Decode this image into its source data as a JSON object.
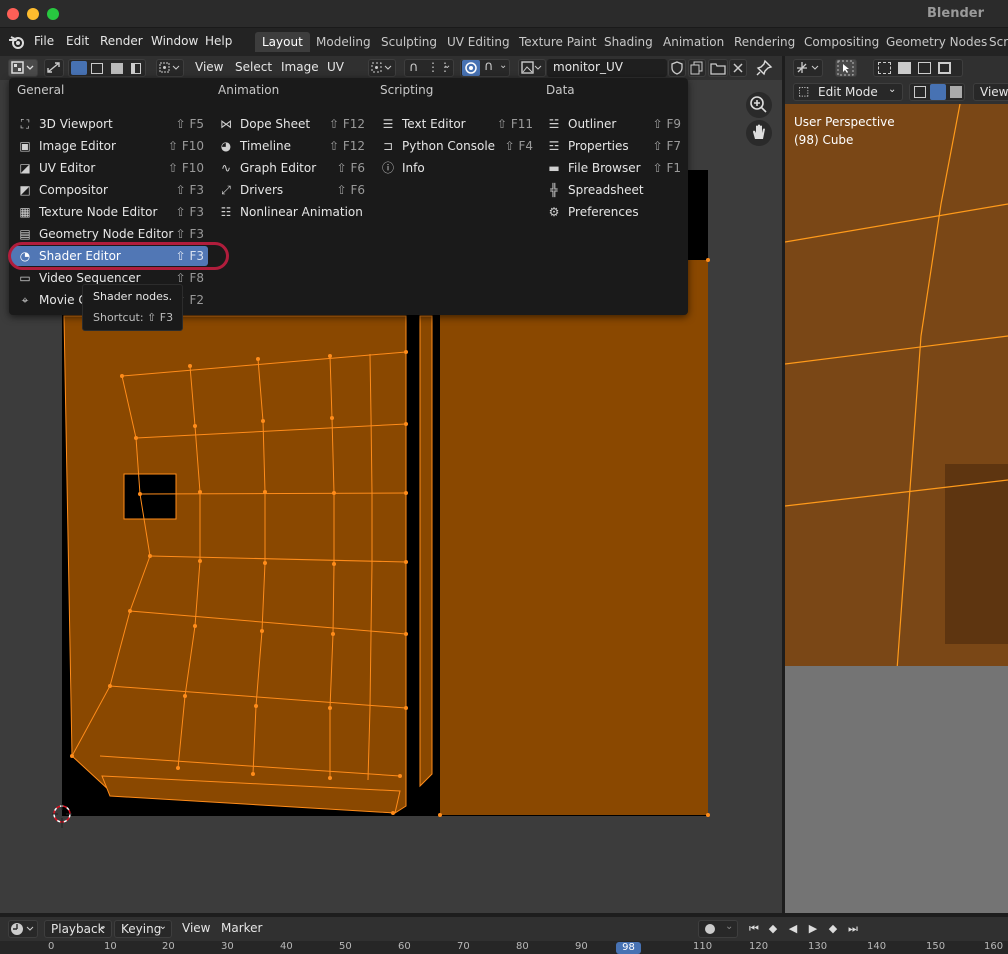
{
  "window": {
    "title": "Blender"
  },
  "menubar": {
    "items": [
      "File",
      "Edit",
      "Render",
      "Window",
      "Help"
    ]
  },
  "workspaces": [
    "Layout",
    "Modeling",
    "Sculpting",
    "UV Editing",
    "Texture Paint",
    "Shading",
    "Animation",
    "Rendering",
    "Compositing",
    "Geometry Nodes",
    "Scri"
  ],
  "uv_header": {
    "menus": [
      "View",
      "Select",
      "Image",
      "UV"
    ],
    "image_name": "monitor_UV"
  },
  "popup": {
    "columns": [
      {
        "title": "General",
        "items": [
          {
            "label": "3D Viewport",
            "shortcut": "⇧ F5",
            "icon": "cube-icon"
          },
          {
            "label": "Image Editor",
            "shortcut": "⇧ F10",
            "icon": "image-icon"
          },
          {
            "label": "UV Editor",
            "shortcut": "⇧ F10",
            "icon": "uv-icon"
          },
          {
            "label": "Compositor",
            "shortcut": "⇧ F3",
            "icon": "node-icon"
          },
          {
            "label": "Texture Node Editor",
            "shortcut": "⇧ F3",
            "icon": "checker-icon"
          },
          {
            "label": "Geometry Node Editor",
            "shortcut": "⇧ F3",
            "icon": "geometry-icon"
          },
          {
            "label": "Shader Editor",
            "shortcut": "⇧ F3",
            "icon": "shader-icon"
          },
          {
            "label": "Video Sequencer",
            "shortcut": "⇧ F8",
            "icon": "film-icon"
          },
          {
            "label": "Movie Clip Editor",
            "shortcut": "⇧ F2",
            "icon": "tracker-icon"
          }
        ]
      },
      {
        "title": "Animation",
        "items": [
          {
            "label": "Dope Sheet",
            "shortcut": "⇧ F12",
            "icon": "dopesheet-icon"
          },
          {
            "label": "Timeline",
            "shortcut": "⇧ F12",
            "icon": "clock-icon"
          },
          {
            "label": "Graph Editor",
            "shortcut": "⇧ F6",
            "icon": "graph-icon"
          },
          {
            "label": "Drivers",
            "shortcut": "⇧ F6",
            "icon": "drivers-icon"
          },
          {
            "label": "Nonlinear Animation",
            "shortcut": "",
            "icon": "nla-icon"
          }
        ]
      },
      {
        "title": "Scripting",
        "items": [
          {
            "label": "Text Editor",
            "shortcut": "⇧ F11",
            "icon": "text-icon"
          },
          {
            "label": "Python Console",
            "shortcut": "⇧ F4",
            "icon": "console-icon"
          },
          {
            "label": "Info",
            "shortcut": "",
            "icon": "info-icon"
          }
        ]
      },
      {
        "title": "Data",
        "items": [
          {
            "label": "Outliner",
            "shortcut": "⇧ F9",
            "icon": "outliner-icon"
          },
          {
            "label": "Properties",
            "shortcut": "⇧ F7",
            "icon": "properties-icon"
          },
          {
            "label": "File Browser",
            "shortcut": "⇧ F1",
            "icon": "folder-icon"
          },
          {
            "label": "Spreadsheet",
            "shortcut": "",
            "icon": "spreadsheet-icon"
          },
          {
            "label": "Preferences",
            "shortcut": "",
            "icon": "gear-icon"
          }
        ]
      }
    ],
    "tooltip": {
      "description": "Shader nodes.",
      "shortcut": "Shortcut: ⇧ F3"
    }
  },
  "viewport": {
    "mode": "Edit Mode",
    "view_menu": "View",
    "perspective": "User Perspective",
    "object": "(98) Cube"
  },
  "timeline": {
    "menus": [
      "Playback",
      "Keying",
      "View",
      "Marker"
    ],
    "ticks": [
      "0",
      "10",
      "20",
      "30",
      "40",
      "50",
      "60",
      "70",
      "80",
      "90",
      "98",
      "110",
      "120",
      "130",
      "140",
      "150",
      "160"
    ],
    "current_frame": "98"
  },
  "colors": {
    "accent": "#5177b5",
    "highlight_ring": "#b01d3c",
    "uv_face": "#8a4800",
    "uv_edge": "#ff8c1a"
  }
}
